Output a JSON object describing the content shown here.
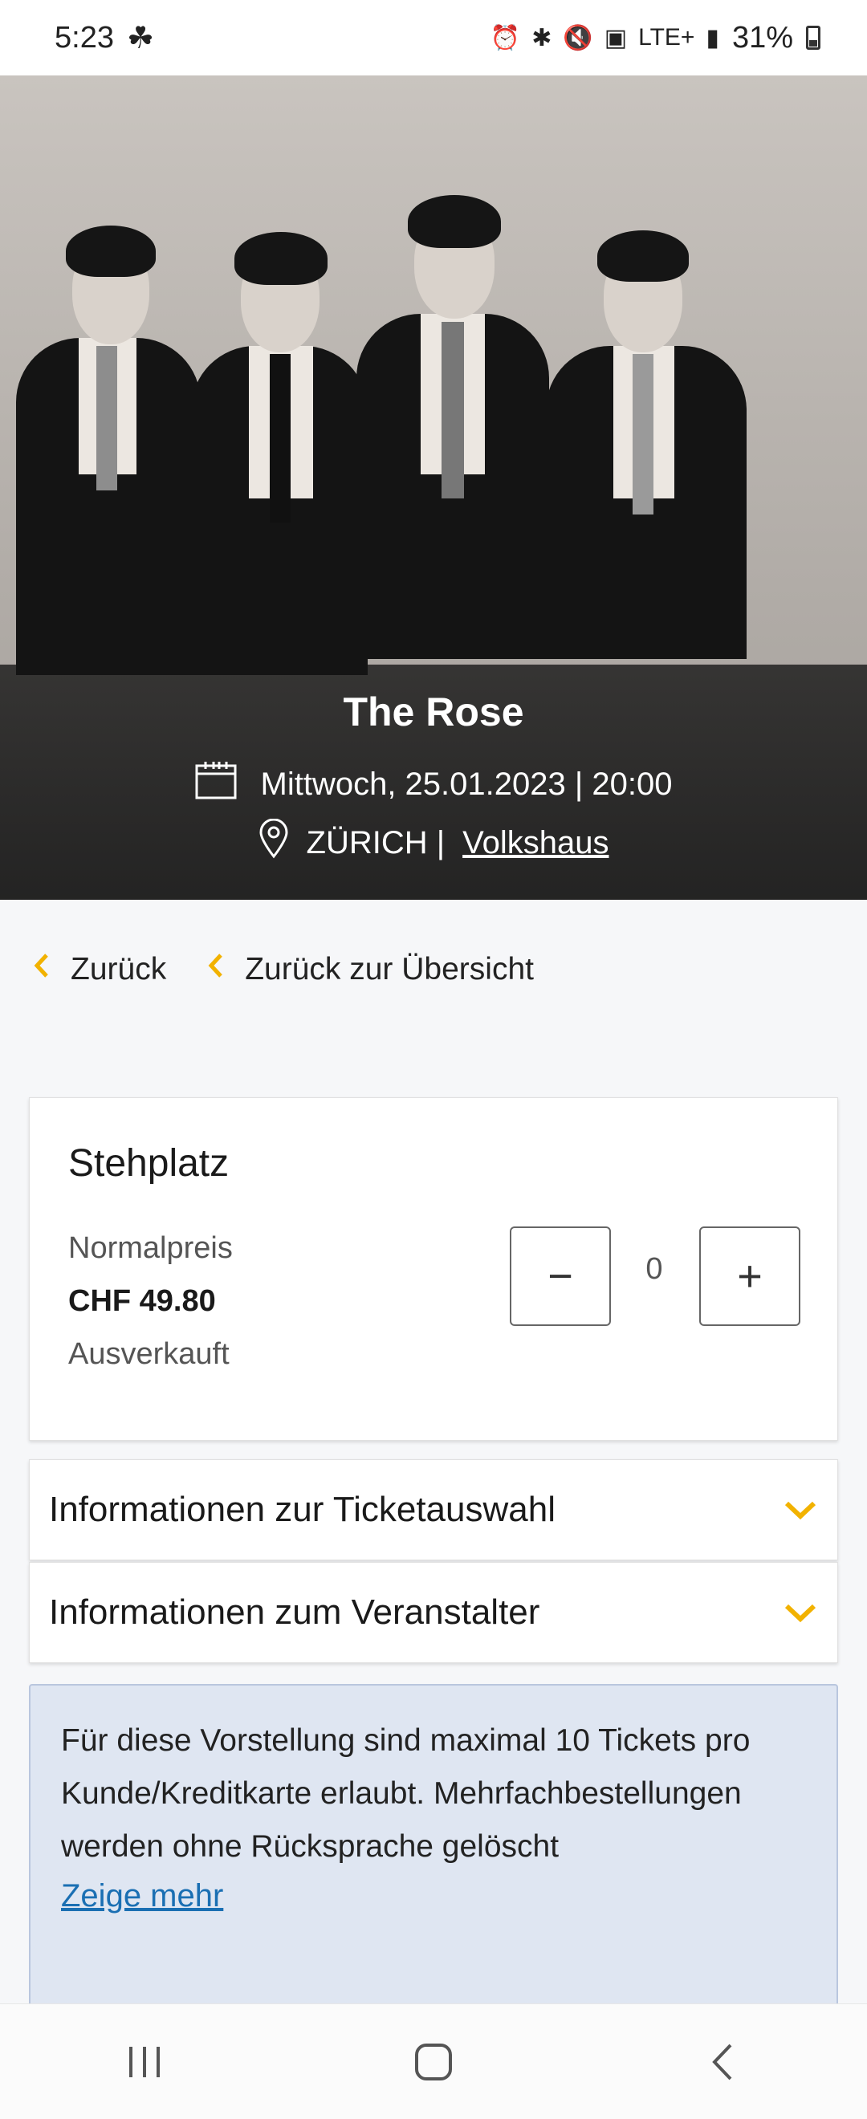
{
  "status_bar": {
    "time": "5:23",
    "battery": "31%",
    "network": "LTE+"
  },
  "event": {
    "title": "The Rose",
    "datetime": "Mittwoch, 25.01.2023 | 20:00",
    "city": "ZÜRICH |",
    "venue": "Volkshaus"
  },
  "navigation": {
    "back_label": "Zurück",
    "overview_label": "Zurück zur Übersicht"
  },
  "ticket": {
    "category": "Stehplatz",
    "price_label": "Normalpreis",
    "price_value": "CHF 49.80",
    "availability": "Ausverkauft",
    "quantity": "0",
    "minus_symbol": "−",
    "plus_symbol": "+"
  },
  "accordions": [
    {
      "label": "Informationen zur Ticketauswahl"
    },
    {
      "label": "Informationen zum Veranstalter"
    }
  ],
  "notice": {
    "text": "Für diese Vorstellung sind maximal 10 Tickets pro Kunde/Kreditkarte erlaubt. Mehrfachbestellungen werden ohne Rücksprache gelöscht",
    "more_link": "Zeige mehr"
  },
  "icons": {
    "calendar": "calendar-icon",
    "location": "location-pin-icon",
    "chevron_left": "chevron-left-icon",
    "chevron_down": "chevron-down-icon"
  },
  "colors": {
    "accent": "#f2b200",
    "notice_bg": "#dfe6f2",
    "link": "#1a6fb3"
  }
}
